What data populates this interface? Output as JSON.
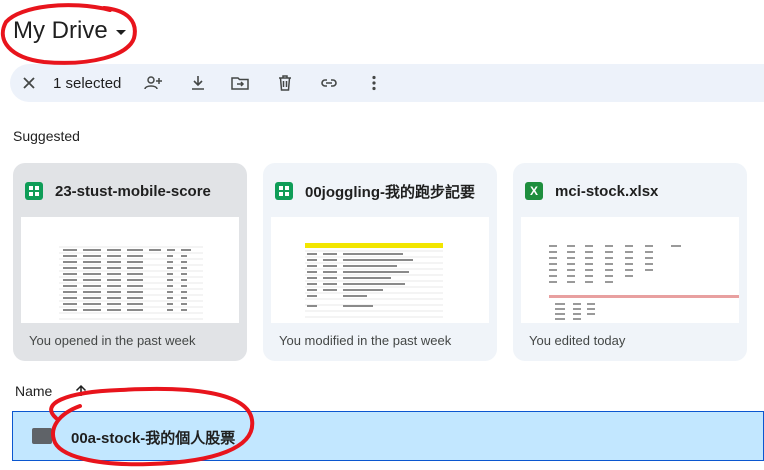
{
  "header": {
    "title": "My Drive"
  },
  "toolbar": {
    "selected_label": "1 selected",
    "actions": [
      "close-icon",
      "share-icon",
      "download-icon",
      "move-icon",
      "trash-icon",
      "link-icon",
      "more-vert-icon"
    ]
  },
  "suggested": {
    "label": "Suggested",
    "cards": [
      {
        "name": "23-stust-mobile-score",
        "icon": "google-sheets-icon",
        "footer": "You opened in the past week"
      },
      {
        "name": "00joggling-我的跑步記要",
        "icon": "google-sheets-icon",
        "footer": "You modified in the past week"
      },
      {
        "name": "mci-stock.xlsx",
        "icon": "excel-icon",
        "footer": "You edited today"
      }
    ]
  },
  "list": {
    "column_label": "Name",
    "rows": [
      {
        "name": "00a-stock-我的個人股票",
        "icon": "folder-icon"
      }
    ]
  },
  "colors": {
    "selection": "#c2e7ff",
    "toolbar": "#edf2fa",
    "annotation": "#e8141c"
  }
}
